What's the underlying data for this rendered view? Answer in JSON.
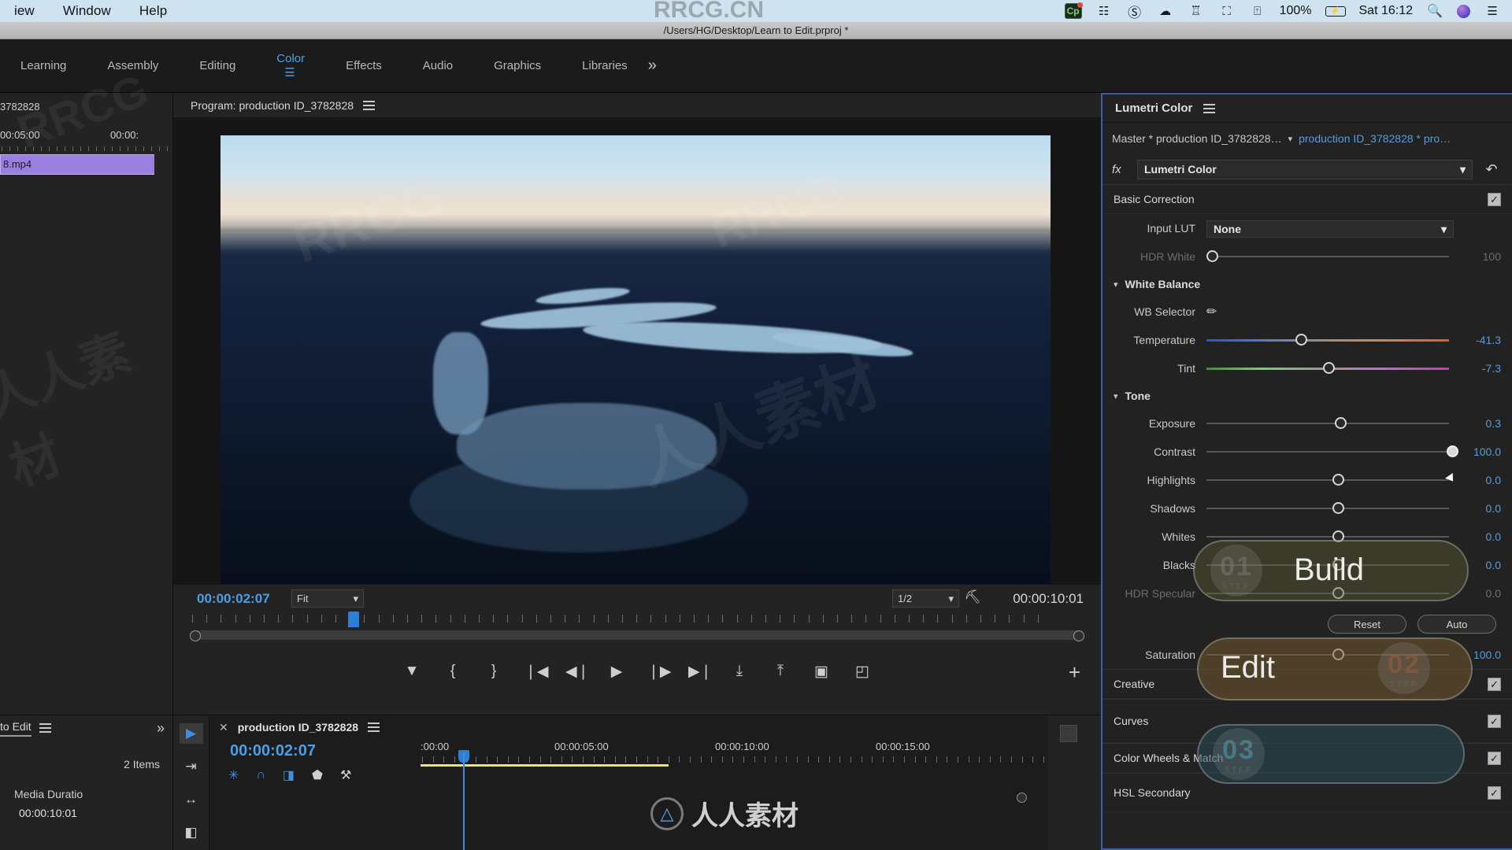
{
  "macbar": {
    "menus": [
      "iew",
      "Window",
      "Help"
    ],
    "tray_icons": [
      "capture-one-icon",
      "network-icon",
      "shazam-icon",
      "cloud-warning-icon",
      "malwarebytes-icon",
      "airplay-icon",
      "wifi-icon"
    ],
    "battery_percent": "100%",
    "battery_icon": "battery-charging-icon",
    "clock": "Sat 16:12",
    "search_icon": "search-icon",
    "siri_icon": "siri-icon",
    "control_center_icon": "control-center-icon"
  },
  "titlebar": {
    "path": "/Users/HG/Desktop/Learn to Edit.prproj *"
  },
  "workspaces": {
    "items": [
      {
        "label": "Learning",
        "active": false
      },
      {
        "label": "Assembly",
        "active": false
      },
      {
        "label": "Editing",
        "active": false
      },
      {
        "label": "Color",
        "active": true
      },
      {
        "label": "Effects",
        "active": false
      },
      {
        "label": "Audio",
        "active": false
      },
      {
        "label": "Graphics",
        "active": false
      },
      {
        "label": "Libraries",
        "active": false
      }
    ],
    "overflow": "»"
  },
  "source_strip": {
    "title_partial": "3782828",
    "tick_label_1": "00:05:00",
    "tick_label_2": "00:00:",
    "clip_name": "8.mp4"
  },
  "program": {
    "title": "Program: production ID_3782828",
    "menu_icon": "panel-menu-icon",
    "current_timecode": "00:00:02:07",
    "zoom_level": "Fit",
    "playback_resolution": "1/2",
    "settings_icon": "wrench-icon",
    "duration_timecode": "00:00:10:01",
    "transport": [
      {
        "name": "add-marker-button",
        "glyph": "▼"
      },
      {
        "name": "mark-in-button",
        "glyph": "{"
      },
      {
        "name": "mark-out-button",
        "glyph": "}"
      },
      {
        "name": "go-to-in-button",
        "glyph": "❘◀"
      },
      {
        "name": "step-back-button",
        "glyph": "◀❘"
      },
      {
        "name": "play-stop-button",
        "glyph": "▶"
      },
      {
        "name": "step-forward-button",
        "glyph": "❘▶"
      },
      {
        "name": "go-to-out-button",
        "glyph": "▶❘"
      },
      {
        "name": "lift-button",
        "glyph": "⤓"
      },
      {
        "name": "extract-button",
        "glyph": "⤒"
      },
      {
        "name": "export-frame-button",
        "glyph": "▣"
      },
      {
        "name": "comparison-view-button",
        "glyph": "◰"
      }
    ],
    "button_editor": "+"
  },
  "lumetri": {
    "panel_title": "Lumetri Color",
    "panel_menu_icon": "panel-menu-icon",
    "master_clip": "Master * production ID_3782828…",
    "clip_link": "production ID_3782828 * pro…",
    "fx_label": "fx",
    "effect_name": "Lumetri Color",
    "reset_icon": "reset-icon",
    "basic_correction": {
      "title": "Basic Correction",
      "enabled": true,
      "input_lut_label": "Input LUT",
      "input_lut_value": "None",
      "hdr_white_label": "HDR White",
      "hdr_white_value": "100",
      "white_balance": {
        "title": "White Balance",
        "wb_selector_label": "WB Selector",
        "wb_selector_icon": "eyedropper-icon",
        "sliders": [
          {
            "label": "Temperature",
            "value": "-41.3",
            "pos": 36
          },
          {
            "label": "Tint",
            "value": "-7.3",
            "pos": 47
          }
        ]
      },
      "tone": {
        "title": "Tone",
        "sliders": [
          {
            "label": "Exposure",
            "value": "0.3",
            "pos": 52,
            "dim": false
          },
          {
            "label": "Contrast",
            "value": "100.0",
            "pos": 99,
            "dim": false
          },
          {
            "label": "Highlights",
            "value": "0.0",
            "pos": 51,
            "dim": false
          },
          {
            "label": "Shadows",
            "value": "0.0",
            "pos": 51,
            "dim": false
          },
          {
            "label": "Whites",
            "value": "0.0",
            "pos": 51,
            "dim": false
          },
          {
            "label": "Blacks",
            "value": "0.0",
            "pos": 51,
            "dim": false
          },
          {
            "label": "HDR Specular",
            "value": "0.0",
            "pos": 51,
            "dim": true
          }
        ],
        "reset_button": "Reset",
        "auto_button": "Auto",
        "saturation": {
          "label": "Saturation",
          "value": "100.0",
          "pos": 51
        }
      }
    },
    "sections": [
      {
        "title": "Creative",
        "enabled": true
      },
      {
        "title": "Curves",
        "enabled": true
      },
      {
        "title": "Color Wheels & Match",
        "enabled": true
      },
      {
        "title": "HSL Secondary",
        "enabled": true
      }
    ]
  },
  "project_panel": {
    "title_partial": "to Edit",
    "menu_icon": "panel-menu-icon",
    "overflow_icon": "chevron-double-right-icon",
    "item_count": "2 Items",
    "media_duration_label": "Media Duratio",
    "media_duration_value": "00:00:10:01"
  },
  "tools": [
    {
      "name": "selection-tool",
      "glyph": "▶",
      "selected": true
    },
    {
      "name": "track-select-forward-tool",
      "glyph": "⇥",
      "selected": false
    },
    {
      "name": "ripple-edit-tool",
      "glyph": "↔",
      "selected": false
    },
    {
      "name": "slip-tool",
      "glyph": "◧",
      "selected": false
    }
  ],
  "timeline": {
    "close_icon": "close-icon",
    "sequence_name": "production ID_3782828",
    "menu_icon": "panel-menu-icon",
    "playhead_timecode": "00:00:02:07",
    "toggles": [
      {
        "name": "nest-toggle",
        "glyph": "✳",
        "active": true
      },
      {
        "name": "snap-toggle",
        "glyph": "∩",
        "active": true
      },
      {
        "name": "linked-selection-toggle",
        "glyph": "◨",
        "active": true
      },
      {
        "name": "marker-toggle",
        "glyph": "⬟",
        "active": false
      },
      {
        "name": "timeline-settings-icon",
        "glyph": "⚒",
        "active": false
      }
    ],
    "ruler_labels": [
      ":00:00",
      "00:00:05:00",
      "00:00:10:00",
      "00:00:15:00"
    ]
  },
  "overlay_annotations": [
    {
      "id": "01",
      "step": "STEP",
      "word": "Build"
    },
    {
      "id": "02",
      "step": "STEP",
      "word": "Edit"
    },
    {
      "id": "03",
      "step": "STEP",
      "word": ""
    }
  ],
  "watermarks": {
    "text_a": "RRCG",
    "text_b": "人人素材",
    "site": "RRCG.CN",
    "logo_text": "人人素材"
  },
  "colors": {
    "accent_blue": "#4b9fe8",
    "panel_border": "#3d5ea8",
    "clip_purple": "#9b7fe0",
    "yellow_bar": "#e7e76a"
  }
}
